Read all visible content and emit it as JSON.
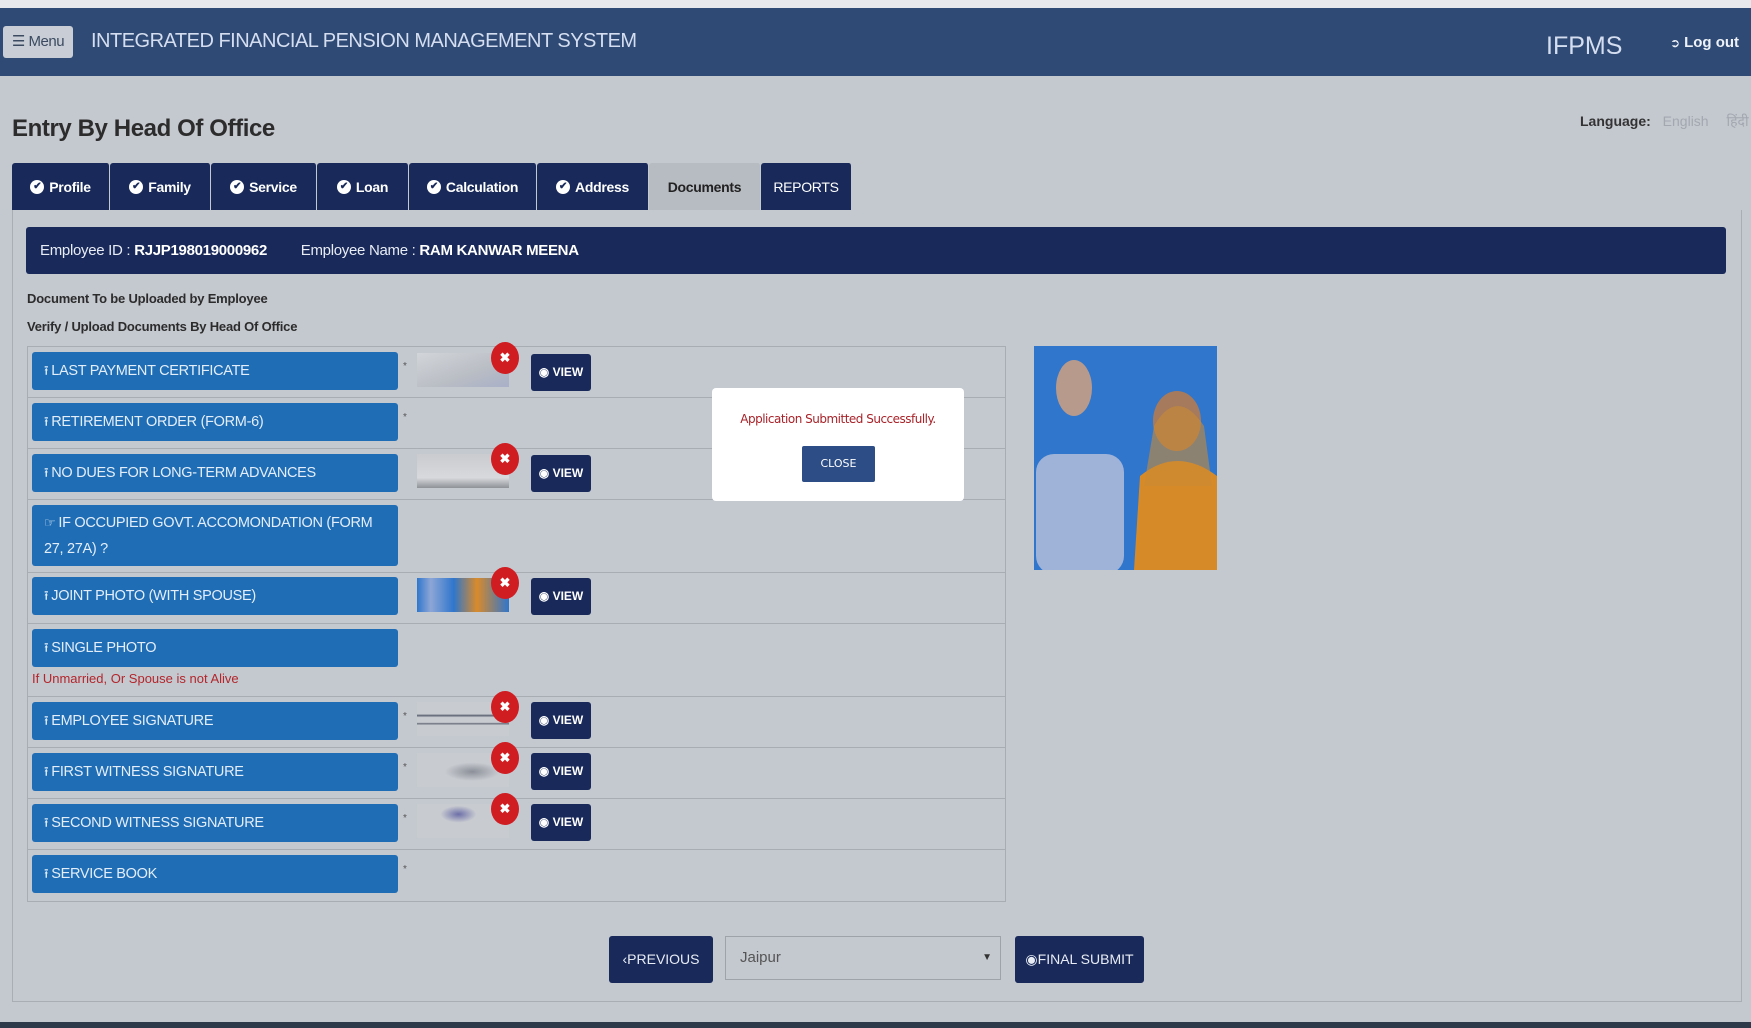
{
  "header": {
    "menu_label": "☰ Menu",
    "app_title": "INTEGRATED FINANCIAL PENSION MANAGEMENT SYSTEM",
    "brand": "IFPMS",
    "logout_label": "Log out"
  },
  "language": {
    "label": "Language:",
    "options": [
      "English",
      "हिंदी"
    ]
  },
  "page_title": "Entry By Head Of Office",
  "tabs": [
    {
      "label": "Profile",
      "checked": true
    },
    {
      "label": "Family",
      "checked": true
    },
    {
      "label": "Service",
      "checked": true
    },
    {
      "label": "Loan",
      "checked": true
    },
    {
      "label": "Calculation",
      "checked": true
    },
    {
      "label": "Address",
      "checked": true
    },
    {
      "label": "Documents",
      "checked": false,
      "active": true
    },
    {
      "label": "REPORTS",
      "checked": false
    }
  ],
  "employee": {
    "id_label": "Employee ID :",
    "id": "RJJP198019000962",
    "name_label": "Employee Name :",
    "name": "RAM KANWAR MEENA"
  },
  "hints": {
    "employee_upload": "Document To be Uploaded by Employee",
    "hoo_verify": "Verify / Upload Documents By Head Of Office"
  },
  "documents": [
    {
      "label": "LAST PAYMENT CERTIFICATE",
      "icon": "upload-icon",
      "required": true,
      "uploaded": true,
      "view_label": "VIEW"
    },
    {
      "label": "RETIREMENT ORDER (FORM-6)",
      "icon": "upload-icon",
      "required": true,
      "uploaded": false
    },
    {
      "label": "NO DUES FOR LONG-TERM ADVANCES",
      "icon": "upload-icon",
      "required": false,
      "uploaded": true,
      "view_label": "VIEW"
    },
    {
      "label": "IF OCCUPIED GOVT. ACCOMONDATION (FORM 27, 27A) ?",
      "icon": "hand-pointer-icon",
      "required": false,
      "uploaded": false
    },
    {
      "label": "JOINT PHOTO (WITH SPOUSE)",
      "icon": "upload-icon",
      "required": false,
      "uploaded": true,
      "view_label": "VIEW"
    },
    {
      "label": "SINGLE PHOTO",
      "icon": "upload-icon",
      "required": false,
      "uploaded": false,
      "note": "If Unmarried, Or Spouse is not Alive"
    },
    {
      "label": "EMPLOYEE SIGNATURE",
      "icon": "upload-icon",
      "required": true,
      "uploaded": true,
      "view_label": "VIEW"
    },
    {
      "label": "FIRST WITNESS SIGNATURE",
      "icon": "upload-icon",
      "required": true,
      "uploaded": true,
      "view_label": "VIEW"
    },
    {
      "label": "SECOND WITNESS SIGNATURE",
      "icon": "upload-icon",
      "required": true,
      "uploaded": true,
      "view_label": "VIEW"
    },
    {
      "label": "SERVICE BOOK",
      "icon": "upload-icon",
      "required": true,
      "uploaded": false
    }
  ],
  "modal": {
    "message": "Application Submitted Successfully.",
    "close_label": "CLOSE"
  },
  "footer_actions": {
    "previous_label": "PREVIOUS",
    "treasury_select_value": "Jaipur",
    "final_submit_label": "FINAL SUBMIT"
  },
  "colors": {
    "navbar": "#2f4a74",
    "tab": "#18295a",
    "doc_button": "#1f6db5",
    "delete": "#d01d22",
    "note": "#b3262b"
  }
}
